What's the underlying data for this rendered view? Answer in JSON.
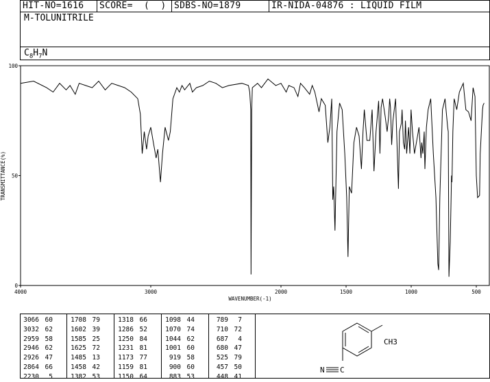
{
  "header": {
    "hit_no": "HIT-NO=1616",
    "score": "SCORE=  (  )",
    "sdbs_no": "SDBS-NO=1879",
    "ir_nida": "IR-NIDA-04876 : LIQUID FILM"
  },
  "compound": {
    "name": "M-TOLUNITRILE",
    "formula_parts": [
      "C",
      "8",
      "H",
      "7",
      "N"
    ]
  },
  "chart_data": {
    "type": "line",
    "xlabel": "WAVENUMBER(-1)",
    "ylabel": "TRANSMITTANCE(%)",
    "xlim": [
      4000,
      400
    ],
    "ylim": [
      0,
      100
    ],
    "xticks": [
      4000,
      3000,
      2000,
      1500,
      1000,
      500
    ],
    "yticks": [
      0,
      50,
      100
    ],
    "x": [
      4000,
      3900,
      3800,
      3750,
      3700,
      3650,
      3620,
      3580,
      3550,
      3500,
      3450,
      3400,
      3350,
      3300,
      3250,
      3200,
      3150,
      3100,
      3080,
      3066,
      3050,
      3032,
      3020,
      3000,
      2980,
      2959,
      2946,
      2926,
      2910,
      2890,
      2864,
      2850,
      2830,
      2800,
      2780,
      2760,
      2740,
      2700,
      2680,
      2650,
      2600,
      2550,
      2500,
      2450,
      2400,
      2300,
      2250,
      2240,
      2232,
      2230,
      2225,
      2220,
      2200,
      2180,
      2150,
      2100,
      2060,
      2040,
      2000,
      1960,
      1940,
      1900,
      1870,
      1850,
      1820,
      1780,
      1760,
      1740,
      1708,
      1690,
      1660,
      1640,
      1625,
      1610,
      1602,
      1595,
      1585,
      1570,
      1550,
      1530,
      1510,
      1495,
      1485,
      1475,
      1458,
      1440,
      1420,
      1400,
      1382,
      1370,
      1360,
      1340,
      1318,
      1300,
      1286,
      1270,
      1250,
      1240,
      1231,
      1220,
      1200,
      1185,
      1173,
      1165,
      1159,
      1150,
      1140,
      1120,
      1098,
      1090,
      1075,
      1070,
      1060,
      1050,
      1044,
      1035,
      1020,
      1010,
      1001,
      990,
      975,
      960,
      940,
      925,
      919,
      910,
      900,
      895,
      883,
      870,
      850,
      830,
      810,
      795,
      789,
      780,
      760,
      740,
      720,
      715,
      710,
      700,
      690,
      687,
      680,
      670,
      650,
      630,
      600,
      580,
      560,
      540,
      525,
      510,
      500,
      490,
      475,
      470,
      457,
      452,
      448,
      440,
      430,
      420,
      410,
      400
    ],
    "y": [
      92,
      93,
      90,
      88,
      92,
      89,
      91,
      87,
      92,
      91,
      90,
      93,
      89,
      92,
      91,
      90,
      88,
      85,
      78,
      60,
      70,
      62,
      68,
      72,
      65,
      58,
      62,
      47,
      60,
      72,
      66,
      70,
      85,
      90,
      88,
      91,
      89,
      92,
      88,
      90,
      91,
      93,
      92,
      90,
      91,
      92,
      91,
      88,
      80,
      5,
      80,
      90,
      91,
      92,
      90,
      94,
      92,
      91,
      92,
      88,
      91,
      90,
      86,
      92,
      90,
      87,
      91,
      88,
      79,
      85,
      82,
      65,
      72,
      85,
      39,
      45,
      25,
      70,
      83,
      80,
      60,
      40,
      13,
      45,
      42,
      65,
      72,
      68,
      53,
      70,
      80,
      66,
      66,
      80,
      52,
      70,
      84,
      60,
      81,
      85,
      77,
      70,
      77,
      85,
      81,
      64,
      75,
      85,
      44,
      70,
      74,
      80,
      65,
      62,
      75,
      60,
      72,
      60,
      80,
      70,
      60,
      65,
      72,
      58,
      65,
      60,
      70,
      53,
      72,
      80,
      85,
      60,
      40,
      10,
      7,
      40,
      80,
      85,
      72,
      70,
      4,
      20,
      50,
      47,
      70,
      85,
      80,
      88,
      92,
      80,
      79,
      75,
      90,
      86,
      50,
      40,
      41,
      60,
      75,
      80,
      82,
      83
    ]
  },
  "peak_table": [
    [
      [
        "3066",
        "60"
      ],
      [
        "1708",
        "79"
      ],
      [
        "1318",
        "66"
      ],
      [
        "1098",
        "44"
      ],
      [
        "789",
        "7"
      ]
    ],
    [
      [
        "3032",
        "62"
      ],
      [
        "1602",
        "39"
      ],
      [
        "1286",
        "52"
      ],
      [
        "1070",
        "74"
      ],
      [
        "710",
        "72"
      ]
    ],
    [
      [
        "2959",
        "58"
      ],
      [
        "1585",
        "25"
      ],
      [
        "1250",
        "84"
      ],
      [
        "1044",
        "62"
      ],
      [
        "687",
        "4"
      ]
    ],
    [
      [
        "2946",
        "62"
      ],
      [
        "1625",
        "72"
      ],
      [
        "1231",
        "81"
      ],
      [
        "1001",
        "60"
      ],
      [
        "680",
        "47"
      ]
    ],
    [
      [
        "2926",
        "47"
      ],
      [
        "1485",
        "13"
      ],
      [
        "1173",
        "77"
      ],
      [
        "919",
        "58"
      ],
      [
        "525",
        "79"
      ]
    ],
    [
      [
        "2864",
        "66"
      ],
      [
        "1458",
        "42"
      ],
      [
        "1159",
        "81"
      ],
      [
        "900",
        "60"
      ],
      [
        "457",
        "50"
      ]
    ],
    [
      [
        "2230",
        "5"
      ],
      [
        "1382",
        "53"
      ],
      [
        "1150",
        "64"
      ],
      [
        "883",
        "53"
      ],
      [
        "448",
        "41"
      ]
    ]
  ],
  "structure": {
    "substituent_label": "CH3",
    "nitrile_n": "N",
    "nitrile_c": "C"
  }
}
